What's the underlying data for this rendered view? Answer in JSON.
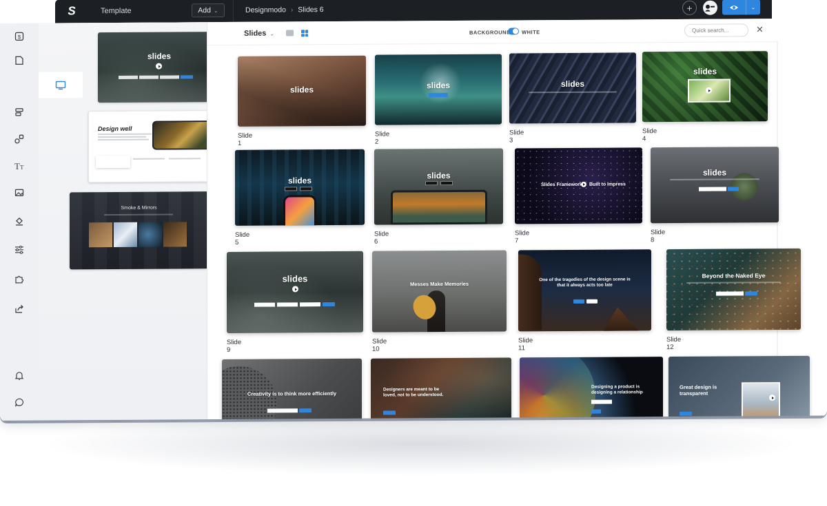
{
  "app": {
    "logo": "S",
    "template_label": "Template",
    "add_button": "Add",
    "breadcrumb": [
      "Designmodo",
      "Slides 6"
    ],
    "breadcrumb_sep": "›",
    "plus_icon": "plus-circle-icon",
    "accent": "#2e86de",
    "topbar_color": "#1c1f24"
  },
  "rail": {
    "items": [
      "dollar-page-icon",
      "page-icon",
      "desktop-icon",
      "align-icon",
      "shapes-icon",
      "text-icon",
      "image-icon",
      "fill-icon",
      "sliders-icon",
      "puzzle-icon",
      "share-icon",
      "bell-icon",
      "chat-icon"
    ]
  },
  "templates_panel": {
    "items": [
      {
        "title": "slides"
      },
      {
        "title": "Design well"
      },
      {
        "title": "Smoke & Mirrors"
      }
    ]
  },
  "toolbar": {
    "slides_label": "Slides",
    "background_label": "BACKGROUND",
    "white_label": "WHITE",
    "search_placeholder": "Quick search...",
    "close_icon": "close-icon"
  },
  "slides": [
    {
      "caption": "Slide 1",
      "title": "slides"
    },
    {
      "caption": "Slide 2",
      "title": "slides"
    },
    {
      "caption": "Slide 3",
      "title": "slides"
    },
    {
      "caption": "Slide 4",
      "title": "slides"
    },
    {
      "caption": "Slide 5",
      "title": "slides"
    },
    {
      "caption": "Slide 6",
      "title": "slides"
    },
    {
      "caption": "Slide 7",
      "title": "Slides Framework",
      "title2": "Built to Impress"
    },
    {
      "caption": "Slide 8",
      "title": "slides"
    },
    {
      "caption": "Slide 9",
      "title": "slides"
    },
    {
      "caption": "Slide 10",
      "title": "Messes Make Memories"
    },
    {
      "caption": "Slide 11",
      "title": "One of the tragedies of the design scene is that it always acts too late"
    },
    {
      "caption": "Slide 12",
      "title": "Beyond the Naked Eye"
    },
    {
      "caption": "",
      "title": "Creativity is to think more efficiently"
    },
    {
      "caption": "",
      "title": "Designers are meant to be loved, not to be understood."
    },
    {
      "caption": "",
      "title": "Designing a product is designing a relationship"
    },
    {
      "caption": "",
      "title": "Great design is transparent"
    }
  ]
}
